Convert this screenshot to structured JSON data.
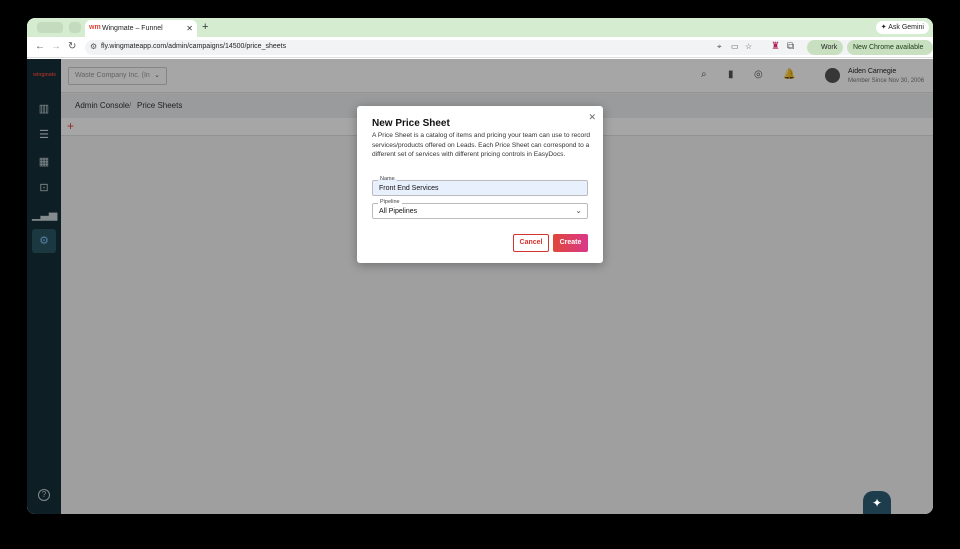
{
  "browser": {
    "tab_title": "Wingmate – Funnel",
    "favicon": "wm",
    "url": "fly.wingmateapp.com/admin/campaigns/14500/price_sheets",
    "profile": "Work",
    "update": "New Chrome available",
    "gemini": "Ask Gemini"
  },
  "header": {
    "company": "Waste Company Inc. (In",
    "user_name": "Aiden Carnegie",
    "user_since": "Member Since Nov 30, 2006"
  },
  "breadcrumb": {
    "root": "Admin Console",
    "sep": "/",
    "current": "Price Sheets"
  },
  "modal": {
    "title": "New Price Sheet",
    "description": "A Price Sheet is a catalog of items and pricing your team can use to record services/products offered on Leads. Each Price Sheet can correspond to a different set of services with different pricing controls in EasyDocs.",
    "name_label": "Name",
    "name_value": "Front End Services",
    "pipeline_label": "Pipeline",
    "pipeline_value": "All Pipelines",
    "cancel": "Cancel",
    "create": "Create"
  },
  "colors": {
    "accent": "#e0463a",
    "sidebar": "#14303a"
  }
}
